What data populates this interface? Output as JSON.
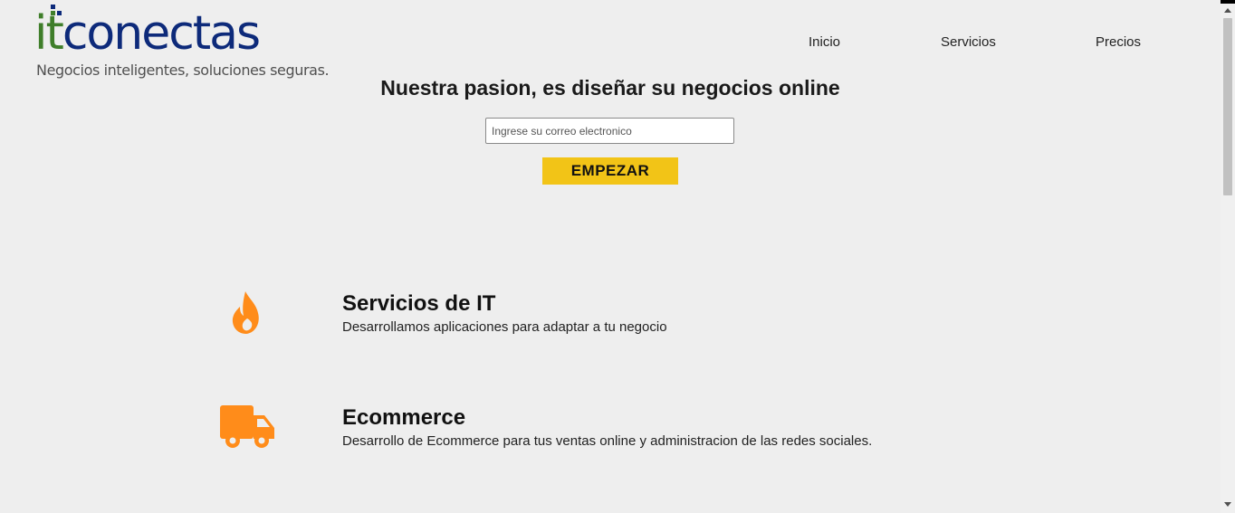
{
  "brand": {
    "logo_it": "it",
    "logo_rest": "conectas",
    "tagline": "Negocios inteligentes, soluciones seguras.",
    "colors": {
      "dark_blue": "#0d2a7a",
      "green": "#3f7e2a"
    }
  },
  "nav": {
    "items": [
      {
        "label": "Inicio"
      },
      {
        "label": "Servicios"
      },
      {
        "label": "Precios"
      }
    ]
  },
  "hero": {
    "title": "Nuestra pasion, es diseñar su negocios online",
    "email_placeholder": "Ingrese su correo electronico",
    "email_value": "",
    "button_label": "EMPEZAR",
    "button_color": "#f2c417"
  },
  "services": [
    {
      "icon": "fire-icon",
      "title": "Servicios de IT",
      "description": "Desarrollamos aplicaciones para adaptar a tu negocio"
    },
    {
      "icon": "truck-icon",
      "title": "Ecommerce",
      "description": "Desarrollo de Ecommerce para tus ventas online y administracion de las redes sociales."
    }
  ],
  "accent_color": "#ff8c1a"
}
